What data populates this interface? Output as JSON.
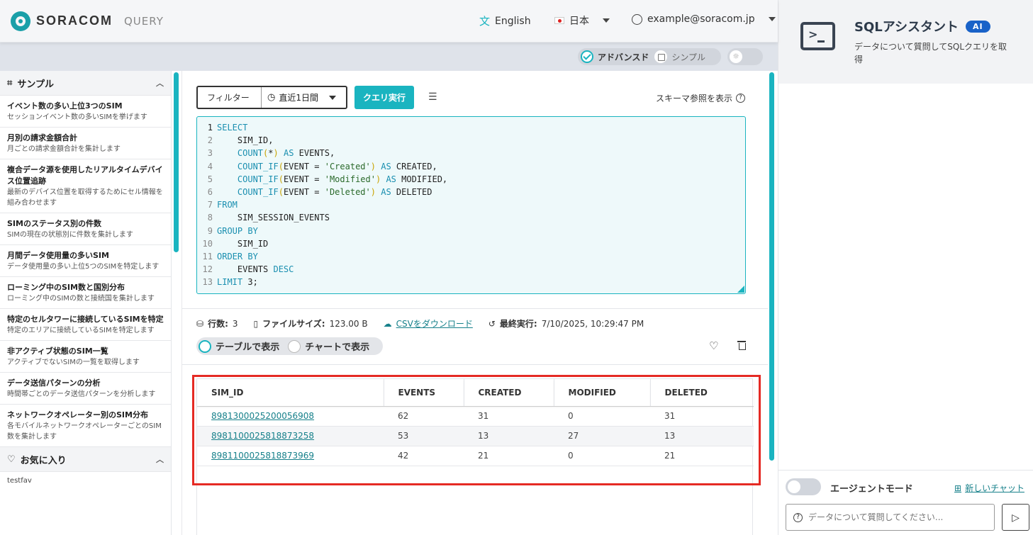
{
  "header": {
    "brand": "SORACOM",
    "product": "QUERY",
    "language_label": "English",
    "region_label": "日本",
    "region_flag": "🇯🇵",
    "user_email": "example@soracom.jp"
  },
  "mode": {
    "advanced_label": "アドバンスド",
    "simple_label": "シンプル"
  },
  "sidebar": {
    "samples_title": "サンプル",
    "items": [
      {
        "title": "イベント数の多い上位3つのSIM",
        "desc": "セッションイベント数の多いSIMを挙げます"
      },
      {
        "title": "月別の請求金額合計",
        "desc": "月ごとの請求金額合計を集計します"
      },
      {
        "title": "複合データ源を使用したリアルタイムデバイス位置追跡",
        "desc": "最新のデバイス位置を取得するためにセル情報を組み合わせます"
      },
      {
        "title": "SIMのステータス別の件数",
        "desc": "SIMの現在の状態別に件数を集計します"
      },
      {
        "title": "月間データ使用量の多いSIM",
        "desc": "データ使用量の多い上位5つのSIMを特定します"
      },
      {
        "title": "ローミング中のSIM数と国別分布",
        "desc": "ローミング中のSIMの数と接続国を集計します"
      },
      {
        "title": "特定のセルタワーに接続しているSIMを特定",
        "desc": "特定のエリアに接続しているSIMを特定します"
      },
      {
        "title": "非アクティブ状態のSIM一覧",
        "desc": "アクティブでないSIMの一覧を取得します"
      },
      {
        "title": "データ送信パターンの分析",
        "desc": "時間帯ごとのデータ送信パターンを分析します"
      },
      {
        "title": "ネットワークオペレーター別のSIM分布",
        "desc": "各モバイルネットワークオペレーターごとのSIM数を集計します"
      }
    ],
    "favorites_title": "お気に入り",
    "favorites": [
      "testfav"
    ]
  },
  "toolbar": {
    "filter_label": "フィルター",
    "range_value": "直近1日間",
    "run_label": "クエリ実行",
    "schema_link": "スキーマ参照を表示"
  },
  "editor": {
    "lines": [
      "SELECT",
      "    SIM_ID,",
      "    COUNT(*) AS EVENTS,",
      "    COUNT_IF(EVENT = 'Created') AS CREATED,",
      "    COUNT_IF(EVENT = 'Modified') AS MODIFIED,",
      "    COUNT_IF(EVENT = 'Deleted') AS DELETED",
      "FROM",
      "    SIM_SESSION_EVENTS",
      "GROUP BY",
      "    SIM_ID",
      "ORDER BY",
      "    EVENTS DESC",
      "LIMIT 3;"
    ]
  },
  "result_meta": {
    "rows_label": "行数:",
    "rows_value": "3",
    "size_label": "ファイルサイズ:",
    "size_value": "123.00 B",
    "download_label": "CSVをダウンロード",
    "last_run_label": "最終実行:",
    "last_run_value": "7/10/2025, 10:29:47 PM"
  },
  "view": {
    "table_label": "テーブルで表示",
    "chart_label": "チャートで表示"
  },
  "results": {
    "columns": [
      "SIM_ID",
      "EVENTS",
      "CREATED",
      "MODIFIED",
      "DELETED"
    ],
    "rows": [
      [
        "8981300025200056908",
        "62",
        "31",
        "0",
        "31"
      ],
      [
        "8981100025818873258",
        "53",
        "13",
        "27",
        "13"
      ],
      [
        "8981100025818873969",
        "42",
        "21",
        "0",
        "21"
      ]
    ]
  },
  "assistant": {
    "title": "SQLアシスタント",
    "badge": "AI",
    "description": "データについて質問してSQLクエリを取得",
    "agent_mode_label": "エージェントモード",
    "new_chat_label": "新しいチャット",
    "input_placeholder": "データについて質問してください..."
  },
  "colors": {
    "accent": "#1ab4c0",
    "highlight": "#e52a24",
    "ai_badge": "#1962c8"
  }
}
